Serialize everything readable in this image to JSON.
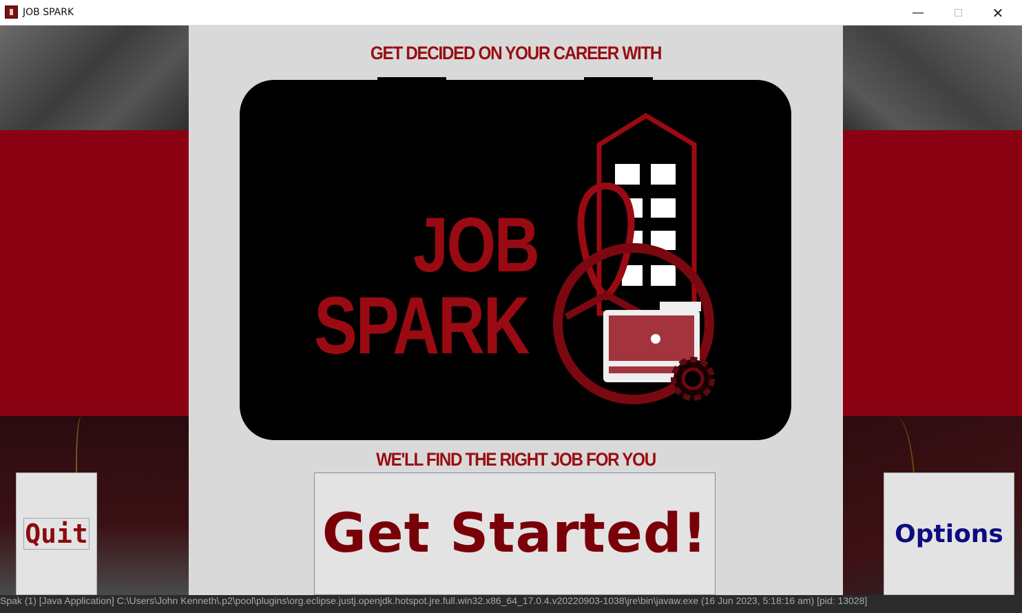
{
  "window": {
    "title": "JOB SPARK",
    "controls": {
      "minimize": "—",
      "close": "✕"
    }
  },
  "headings": {
    "top": "GET DECIDED ON YOUR CAREER WITH",
    "bottom": "WE'LL FIND THE RIGHT JOB FOR YOU"
  },
  "logo": {
    "line1": "JOB",
    "line2": "SPARK",
    "graphic": "building-person-briefcase-gear-logo"
  },
  "buttons": {
    "quit": "Quit",
    "get_started": "Get Started!",
    "options": "Options"
  },
  "console": {
    "text": "Spak (1) [Java Application] C:\\Users\\John Kenneth\\.p2\\pool\\plugins\\org.eclipse.justj.openjdk.hotspot.jre.full.win32.x86_64_17.0.4.v20220903-1038\\jre\\bin\\javaw.exe  (16 Jun 2023, 5:18:16 am) [pid: 13028]"
  },
  "colors": {
    "brand_red": "#8a0212",
    "text_red": "#990d12",
    "options_blue": "#0c0c80",
    "panel_gray": "#d9d9d9"
  }
}
